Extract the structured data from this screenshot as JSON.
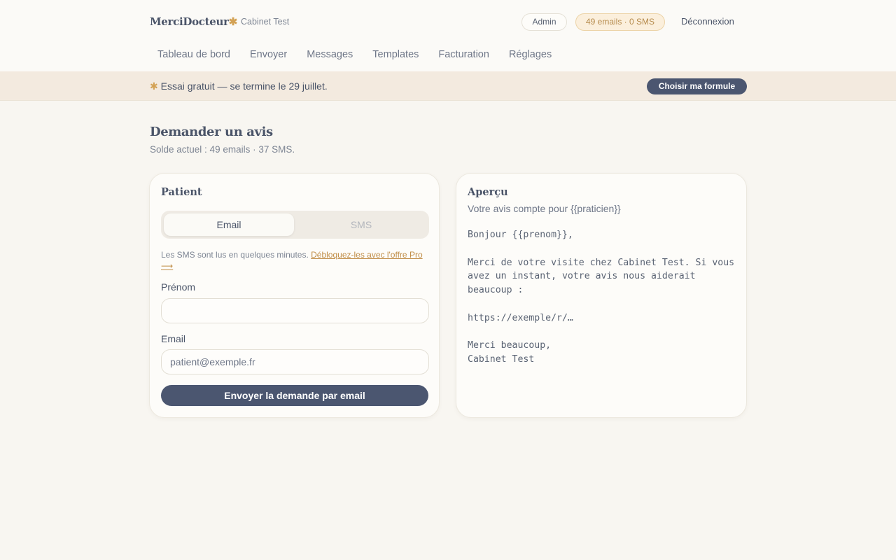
{
  "header": {
    "brand": "MerciDocteur",
    "brand_star": "✱",
    "cabinet": "Cabinet Test",
    "admin_badge": "Admin",
    "quota_badge": "49 emails · 0 SMS",
    "logout": "Déconnexion"
  },
  "nav": {
    "items": [
      "Tableau de bord",
      "Envoyer",
      "Messages",
      "Templates",
      "Facturation",
      "Réglages"
    ]
  },
  "banner": {
    "star": "✱",
    "text": "Essai gratuit — se termine le 29 juillet.",
    "button": "Choisir ma formule"
  },
  "page": {
    "title": "Demander un avis",
    "subtitle": "Solde actuel : 49 emails · 37 SMS."
  },
  "patient_card": {
    "title": "Patient",
    "tabs": {
      "email": "Email",
      "sms": "SMS",
      "selected": "email"
    },
    "hint": "Les SMS sont lus en quelques minutes. ",
    "hint_link": "Débloquez-les avec l'offre Pro ⟶",
    "first_name_label": "Prénom",
    "first_name_value": "",
    "email_label": "Email",
    "email_placeholder": "patient@exemple.fr",
    "submit": "Envoyer la demande par email"
  },
  "preview_card": {
    "title": "Aperçu",
    "subject": "Votre avis compte pour {{praticien}}",
    "body": "Bonjour {{prenom}},\n\nMerci de votre visite chez Cabinet Test. Si vous avez un instant, votre avis nous aiderait beaucoup :\n\nhttps://exemple/r/…\n\nMerci beaucoup,\nCabinet Test"
  },
  "colors": {
    "background": "#f8f6f1",
    "primary": "#4b5670",
    "accent": "#d3a255",
    "banner": "#f3eadf"
  }
}
